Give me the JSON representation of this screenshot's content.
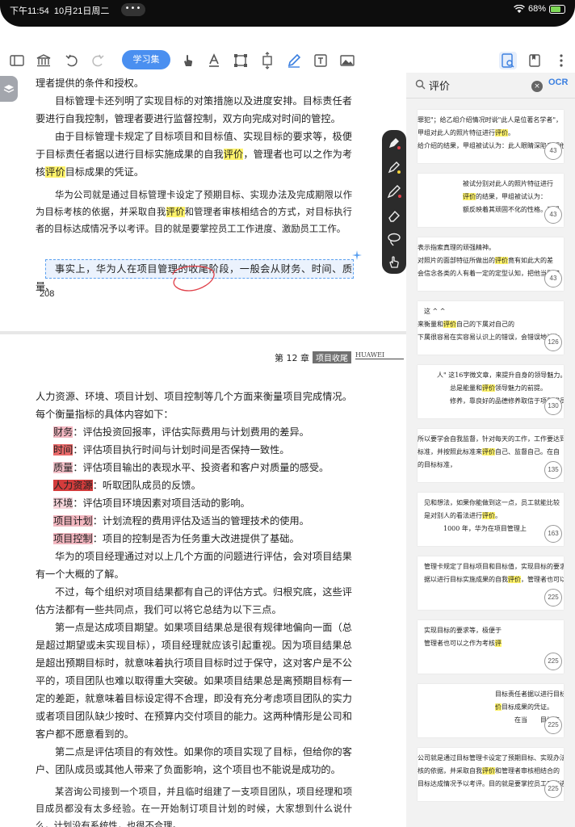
{
  "status": {
    "time": "下午11:54",
    "date": "10月21日周二",
    "dots": "•••",
    "battery": "68%"
  },
  "toolbar": {
    "study_set_label": "学习集"
  },
  "doc": {
    "p1": "理者提供的条件和授权。",
    "p2": "目标管理卡还列明了实现目标的对策措施以及进度安排。目标责任者要进行自我控制，管理者要进行监督控制，双方向完成对时间的管控。",
    "p3a": "由于目标管理卡规定了目标项目和目标值、实现目标的要求等，极便于目标责任者据以进行目标实施成果的自我",
    "p3b": "评价",
    "p3c": "，管理者也可以之作为考核",
    "p3d": "评价",
    "p3e": "目标成果的凭证。",
    "p4a": "华为公司就是通过目标管理卡设定了预期目标、实现办法及完成期限以作为目标考核的依据，并采取自我",
    "p4b": "评价",
    "p4c": "和管理者审核相结合的方式，对目标执行者的目标达成情况予以考评。目的就是要掌控员工工作进度、激励员工工作。",
    "p5a": "事实上，华为人在项目管理的收尾阶段",
    "p5b": "，一般会从财务、时间、质量、",
    "page_num": "208",
    "chapter": "第 12 章",
    "chapter_tag": "项目收尾",
    "huawei": "HUAWEI",
    "p6": "人力资源、环境、项目计划、项目控制等几个方面来衡量项目完成情况。每个衡量指标的具体内容如下：",
    "items": [
      {
        "k": "财务",
        "v": "：评估投资回报率，评估实际费用与计划费用的差异。"
      },
      {
        "k": "时间",
        "v": "：评估项目执行时间与计划时间是否保持一致性。"
      },
      {
        "k": "质量",
        "v": "：评估项目输出的表现水平、投资者和客户对质量的感受。"
      },
      {
        "k": "人力资源",
        "v": "：听取团队成员的反馈。"
      },
      {
        "k": "环境",
        "v": "：评估项目环境因素对项目活动的影响。"
      },
      {
        "k": "项目计划",
        "v": "：计划流程的费用评估及适当的管理技术的使用。"
      },
      {
        "k": "项目控制",
        "v": "：项目的控制是否为任务重大改进提供了基础。"
      }
    ],
    "p7": "华为的项目经理通过对以上几个方面的问题进行评估，会对项目结果有一个大概的了解。",
    "p8": "不过，每个组织对项目结果都有自己的评估方式。归根究底，这些评估方法都有一些共同点，我们可以将它总结为以下三点。",
    "p9": "第一点是达成项目期望。如果项目结果总是很有规律地偏向一面（总是超过期望或未实现目标），项目经理就应该引起重视。因为项目结果总是超出预期目标时，就意味着执行项目目标时过于保守，这对客户是不公平的，项目团队也难以取得重大突破。如果项目结果总是离预期目标有一定的差距，就意味着目标设定得不合理，即没有充分考虑项目团队的实力或者项目团队缺少按时、在预算内交付项目的能力。这两种情形是公司和客户都不愿意看到的。",
    "p10": "第二点是评估项目的有效性。如果你的项目实现了目标，但给你的客户、团队成员或其他人带来了负面影响，这个项目也不能说是成功的。",
    "p11": "某咨询公司接到一个项目，并且临时组建了一支项目团队，项目经理和项目成员都没有太多经验。在一开始制订项目计划的时候，大家想到什么说什么，计划没有系统性，也很不合理。"
  },
  "search": {
    "query": "评价",
    "clear": "×",
    "ocr": "OCR"
  },
  "results": [
    {
      "page": "43",
      "lines": [
        [
          "罪犯\"；给乙组介绍情况时说\"此人是位著名学者\"，",
          ""
        ],
        [
          "甲组对此人的照片特征进行",
          "评价",
          "。"
        ],
        [
          "给介绍的结果，甲组被试认为：此人眼睛深陷表明他凶狠，",
          ""
        ]
      ]
    },
    {
      "page": "43",
      "lines": [
        [
          "　　　　　　　被试分别对此人的照片特征进行",
          ""
        ],
        [
          "　　　　　　　",
          "评价",
          "的结果，甲组被试认为："
        ],
        [
          "　　　　　　　额反映着其顽固不化的性格。乙组",
          ""
        ]
      ]
    },
    {
      "page": "43",
      "lines": [
        [
          "表示指索真理的顽强精神。",
          ""
        ],
        [
          "对照片的面部特征所做出的",
          "评价",
          "竟有如此大的差"
        ],
        [
          "会信念各类的人有着一定的定型认知，把他当罪犯",
          ""
        ]
      ]
    },
    {
      "page": "126",
      "lines": [
        [
          "　这 ^ ^",
          ""
        ],
        [
          "来衡量和",
          "评价",
          "自己的下属对自己的"
        ],
        [
          "下属很容易在实容易认识上的错误，会错误地认为",
          ""
        ]
      ]
    },
    {
      "page": "130",
      "lines": [
        [
          "　　　人\" 这16字微文章，来提升自身的领导魅力。",
          ""
        ],
        [
          "　　　　　总是能量和",
          "评价",
          "领导魅力的前提。"
        ],
        [
          "　　　　　修养，靠良好的品德修养取信于项目成员",
          ""
        ]
      ]
    },
    {
      "page": "135",
      "lines": [
        [
          "所以要学会自我监督，针对每天的工作，工作要达到的目标",
          ""
        ],
        [
          "标准，并按照此标准来",
          "评价",
          "自己、监督自己。在自"
        ],
        [
          "的目标标准，",
          ""
        ]
      ]
    },
    {
      "page": "163",
      "lines": [
        [
          "　见和想法，如果你能做到这一点，员工就能比较",
          ""
        ],
        [
          "　是对别人的看法进行",
          "评价",
          "。"
        ],
        [
          "　　　　1000 年，华为在项目管理上",
          ""
        ]
      ]
    },
    {
      "page": "225",
      "lines": [
        [
          "　管理卡规定了目标项目和目标值，实现目标的要求等，",
          ""
        ],
        [
          "　据以进行目标实施成果的自我",
          "评价",
          "，管理者也可以之作为"
        ],
        [
          "　",
          ""
        ]
      ]
    },
    {
      "page": "225",
      "lines": [
        [
          "　实现目标的要求等，极便于",
          ""
        ],
        [
          "　管理者也可以之作为考核",
          "评",
          ""
        ],
        [
          "",
          ""
        ]
      ]
    },
    {
      "page": "225",
      "lines": [
        [
          "　　　　　　　　　　　　目标责任者据以进行目标实施",
          ""
        ],
        [
          "　　　　　　　　　　　　",
          "价",
          "目标成果的凭证。"
        ],
        [
          "　　　　　　　　　　　　　　　在当　　目标点",
          ""
        ]
      ]
    },
    {
      "page": "225",
      "lines": [
        [
          "公司就是通过目标管理卡设定了预期目标、实现办法",
          ""
        ],
        [
          "核的依据，并采取自我",
          "评价",
          "和管理者审核相结合的"
        ],
        [
          "目标达成情况予以考评。目的就是要掌控员工工作进",
          ""
        ]
      ]
    }
  ]
}
